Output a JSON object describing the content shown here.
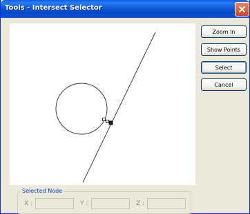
{
  "window": {
    "title": "Tools - Intersect Selector",
    "close_icon": "close-icon"
  },
  "buttons": {
    "zoom_in": "Zoom In",
    "show_points": "Show Points",
    "select": "Select",
    "cancel": "Cancel"
  },
  "selected_node": {
    "label": "Selected Node",
    "x_label": "X :",
    "y_label": "Y :",
    "z_label": "Z :",
    "x_value": "",
    "y_value": "",
    "z_value": ""
  },
  "colors": {
    "title_bar": "#0a5fe0",
    "close_button": "#d4441c",
    "dialog_bg": "#ece9d8",
    "group_label": "#0046d5"
  }
}
